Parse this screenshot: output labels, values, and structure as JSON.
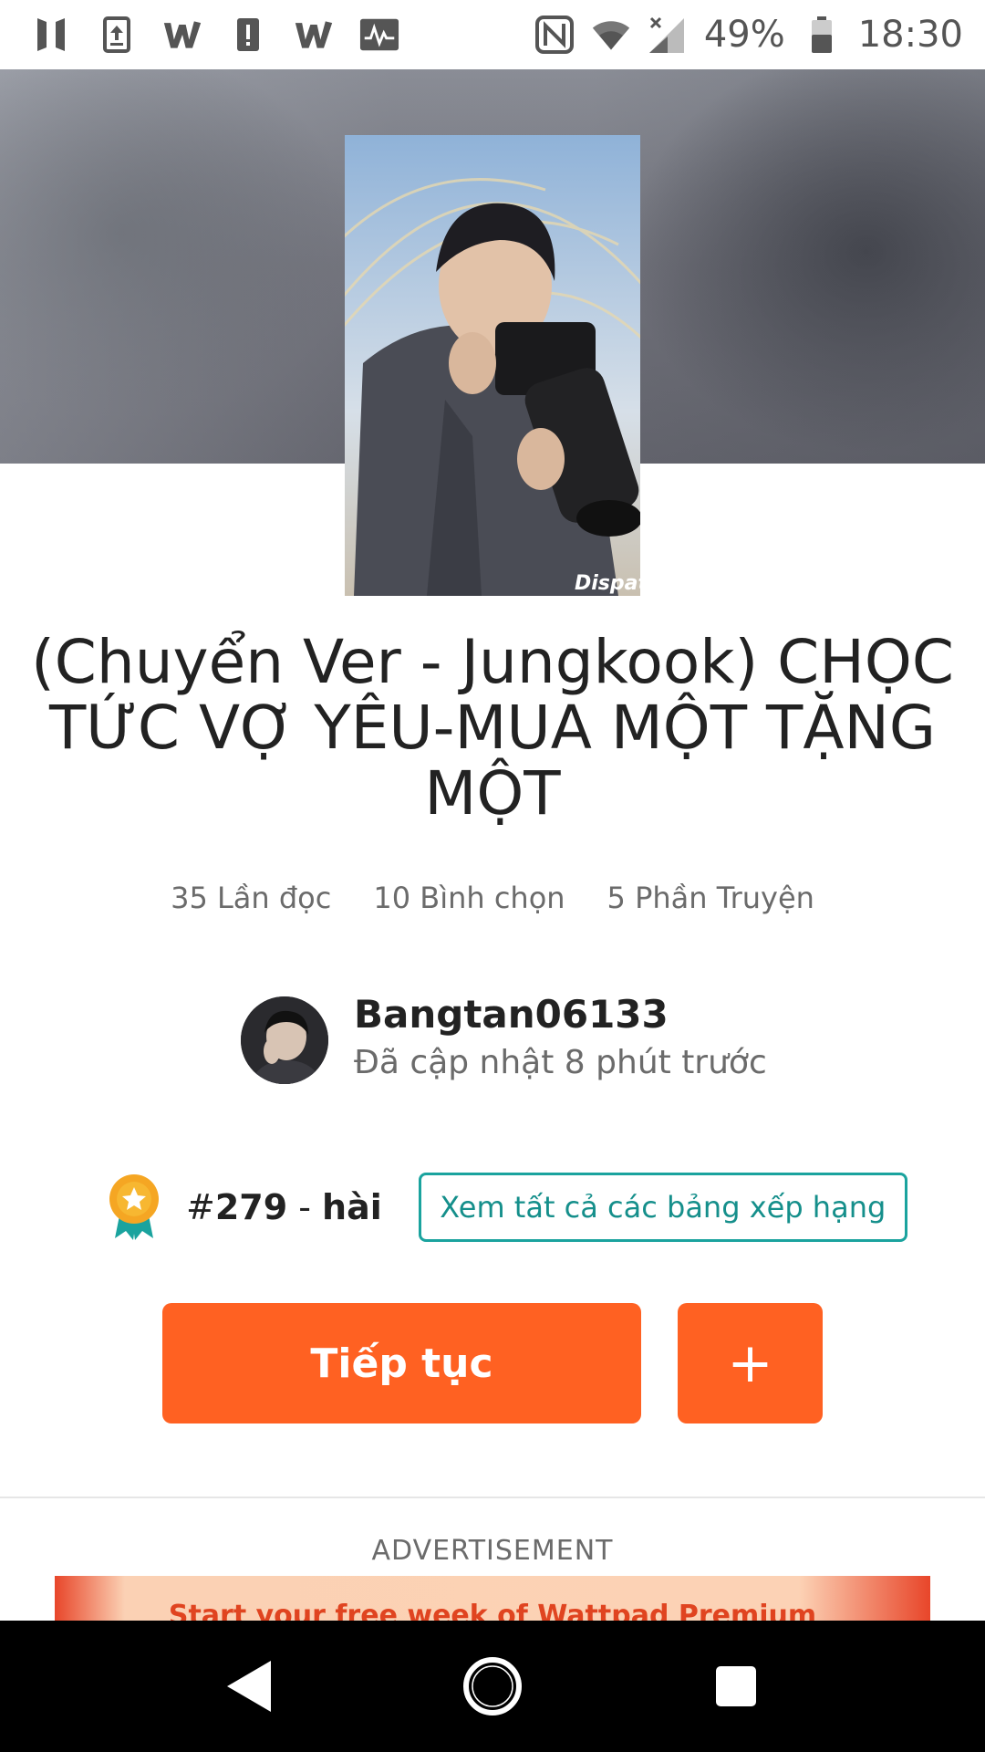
{
  "status_bar": {
    "battery": "49%",
    "time": "18:30",
    "left_icons": [
      "bts-logo-icon",
      "upload-icon",
      "wattpad-icon",
      "alert-icon",
      "wattpad-icon",
      "activity-icon"
    ],
    "right_icons": [
      "nfc-icon",
      "wifi-icon",
      "signal-icon",
      "battery-icon"
    ]
  },
  "story": {
    "title": "(Chuyển Ver - Jungkook) CHỌC TỨC VỢ YÊU-MUA MỘT TẶNG MỘT",
    "stats": {
      "reads": "35 Lần đọc",
      "votes": "10 Bình chọn",
      "parts": "5 Phần Truyện"
    },
    "cover_watermark": "Dispat"
  },
  "author": {
    "name": "Bangtan06133",
    "updated": "Đã cập nhật 8 phút trước"
  },
  "ranking": {
    "prefix": "#",
    "rank": "279",
    "separator": " - ",
    "tag": "hài",
    "view_all_label": "Xem tất cả các bảng xếp hạng"
  },
  "actions": {
    "continue_label": "Tiếp tục",
    "add_label": "+"
  },
  "ad": {
    "label": "ADVERTISEMENT",
    "banner_text": "Start your free week of Wattpad Premium"
  },
  "colors": {
    "accent": "#ff6122",
    "teal": "#1aa39e",
    "nav_background": "#000000"
  },
  "nav": {
    "icons": [
      "back-icon",
      "home-icon",
      "recents-icon"
    ]
  }
}
